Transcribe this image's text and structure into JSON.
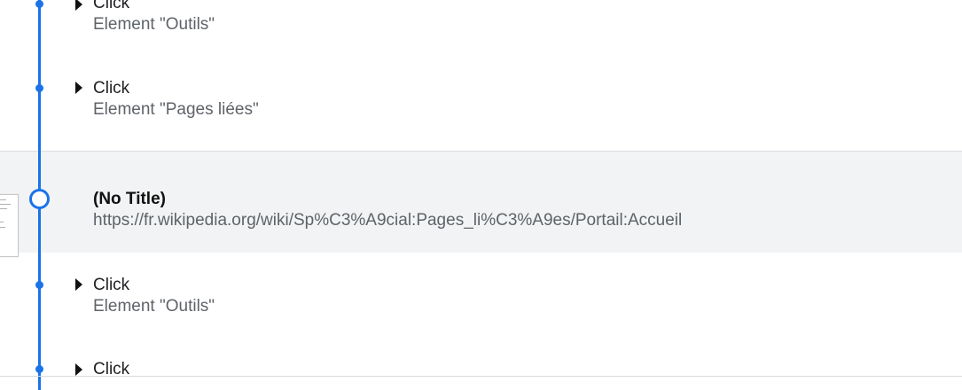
{
  "entries_before": [
    {
      "action": "Click",
      "detail": "Element \"Outils\""
    },
    {
      "action": "Click",
      "detail": "Element \"Pages liées\""
    }
  ],
  "page_visit": {
    "title": "(No Title)",
    "url": "https://fr.wikipedia.org/wiki/Sp%C3%A9cial:Pages_li%C3%A9es/Portail:Accueil"
  },
  "entries_after": [
    {
      "action": "Click",
      "detail": "Element \"Outils\""
    },
    {
      "action": "Click",
      "detail": ""
    }
  ],
  "colors": {
    "accent": "#1a73e8",
    "highlight_bg": "#f1f3f4"
  },
  "icons": {
    "expand": "caret-right-icon",
    "node": "timeline-dot-icon",
    "page_node": "timeline-ring-icon"
  }
}
